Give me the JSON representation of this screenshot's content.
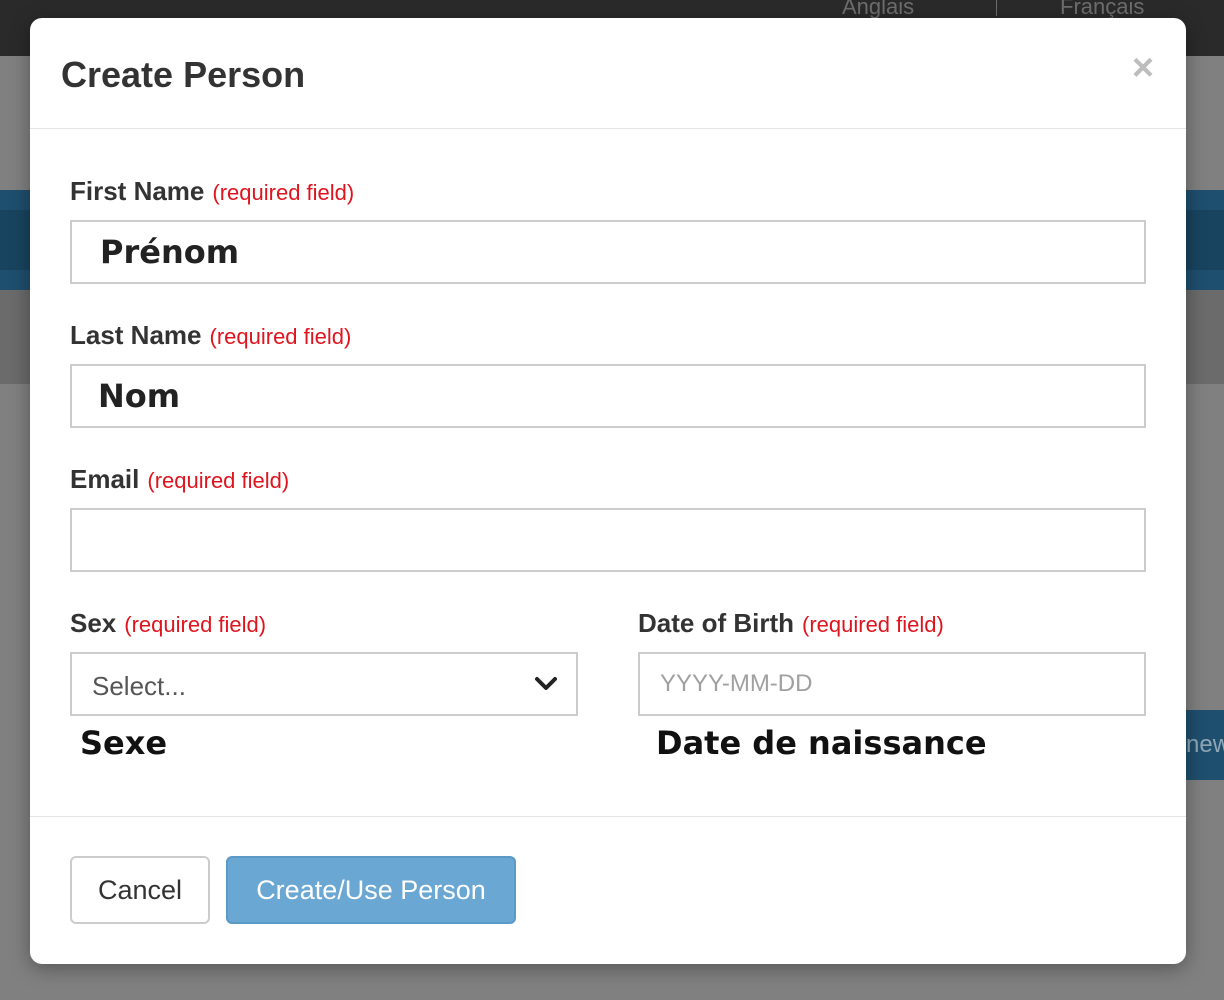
{
  "background": {
    "languages": [
      "Anglais",
      "Français"
    ],
    "partial_button_text": "new"
  },
  "modal": {
    "title": "Create Person",
    "close_symbol": "×",
    "required_marker": "(required field)",
    "fields": {
      "first_name": {
        "label": "First Name",
        "value": "Prénom"
      },
      "last_name": {
        "label": "Last Name",
        "value": "Nom"
      },
      "email": {
        "label": "Email",
        "value": ""
      },
      "sex": {
        "label": "Sex",
        "selected": "Select...",
        "annotation": "Sexe"
      },
      "dob": {
        "label": "Date of Birth",
        "placeholder": "YYYY-MM-DD",
        "annotation": "Date de naissance"
      }
    },
    "buttons": {
      "cancel": "Cancel",
      "submit": "Create/Use Person"
    }
  },
  "colors": {
    "required": "#e0141e",
    "primary_button": "#6aa7d3",
    "overlay": "#808080"
  },
  "icons": {
    "close": "close-icon",
    "select_arrow": "chevron-down-icon"
  }
}
